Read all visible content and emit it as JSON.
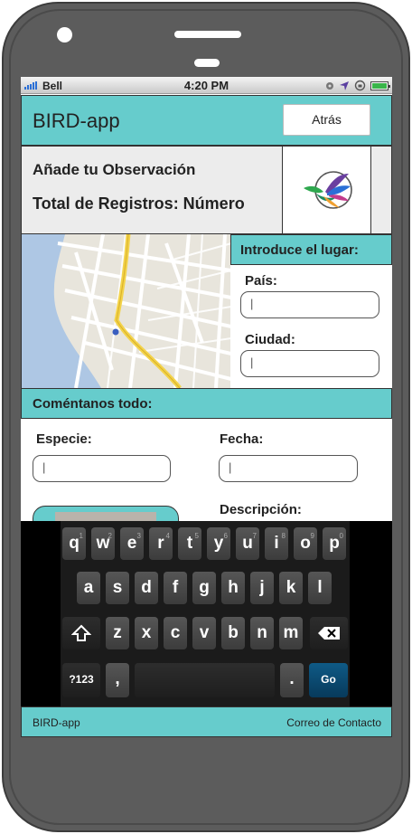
{
  "status_bar": {
    "carrier": "Bell",
    "time": "4:20 PM"
  },
  "header": {
    "app_title": "BIRD-app",
    "back_label": "Atrás"
  },
  "info": {
    "line1": "Añade tu Observación",
    "line2": "Total de Registros: Número",
    "logo_icon": "bird-logo-icon"
  },
  "place": {
    "header": "Introduce el lugar:",
    "country_label": "País:",
    "country_value": "|",
    "city_label": "Ciudad:",
    "city_value": "|"
  },
  "comment": {
    "header": "Coméntanos todo:",
    "species_label": "Especie:",
    "species_value": "|",
    "date_label": "Fecha:",
    "date_value": "|",
    "description_label": "Descripción:"
  },
  "keyboard": {
    "row1": [
      "q",
      "w",
      "e",
      "r",
      "t",
      "y",
      "u",
      "i",
      "o",
      "p"
    ],
    "row1_hints": [
      "1",
      "2",
      "3",
      "4",
      "5",
      "6",
      "7",
      "8",
      "9",
      "0"
    ],
    "row2": [
      "a",
      "s",
      "d",
      "f",
      "g",
      "h",
      "j",
      "k",
      "l"
    ],
    "row3": [
      "z",
      "x",
      "c",
      "v",
      "b",
      "n",
      "m"
    ],
    "shift_icon": "shift-arrow-icon",
    "delete_icon": "backspace-icon",
    "symbols_label": "?123",
    "comma_label": ",",
    "period_label": ".",
    "go_label": "Go"
  },
  "footer": {
    "left": "BIRD-app",
    "right": "Correo de Contacto"
  },
  "colors": {
    "accent": "#66cccc",
    "info_bg": "#ececec",
    "go_key": "#0f5a86",
    "keyboard_bg": "#1b1b1b"
  }
}
